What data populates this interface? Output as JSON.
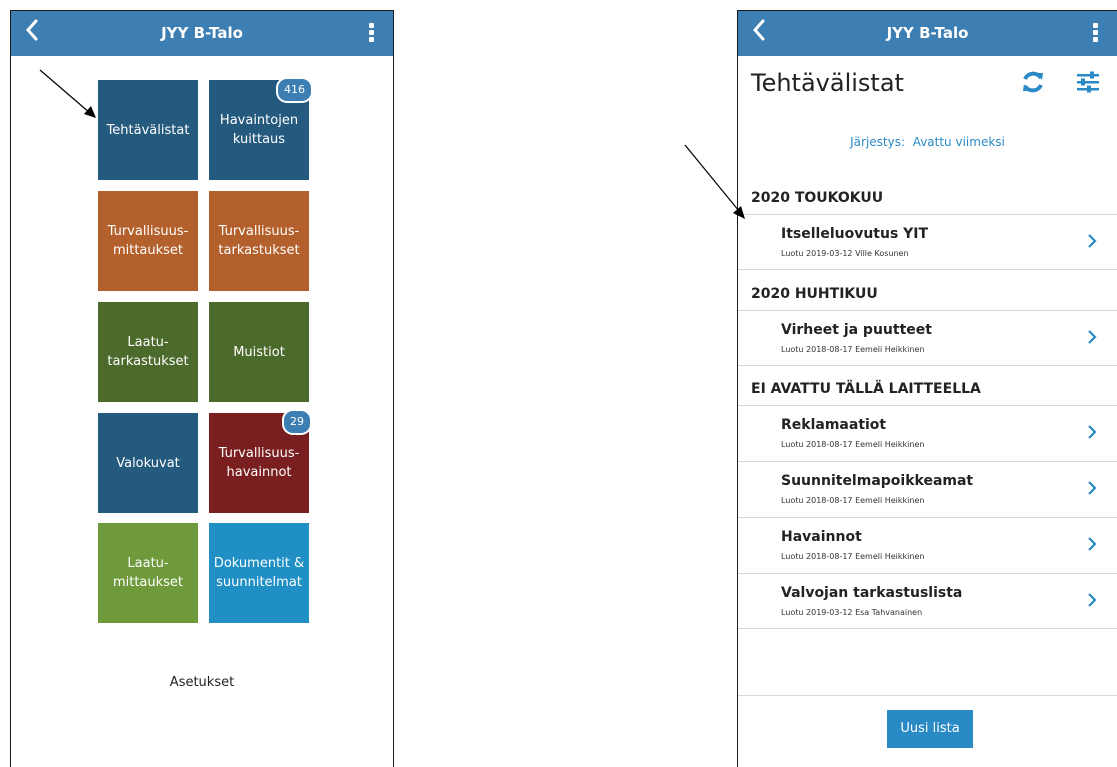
{
  "colors": {
    "appbar": "#3d7fb3",
    "tile_dark_blue": "#255a7f",
    "tile_orange": "#b4602c",
    "tile_dark_green": "#4c6a2b",
    "tile_dark_red": "#7a1f1f",
    "tile_light_green": "#6f9a3b",
    "tile_light_blue": "#1f8fc4",
    "accent_blue": "#2a8ac5"
  },
  "left_screen": {
    "appbar": {
      "title": "JYY B-Talo",
      "back_icon": "chevron-left-icon",
      "menu_icon": "kebab-menu-icon"
    },
    "tiles": [
      {
        "label": "Tehtävälistat",
        "color": "#255a7f"
      },
      {
        "label": "Havaintojen\nkuittaus",
        "color": "#255a7f",
        "badge": "416"
      },
      {
        "label": "Turvallisuus-\nmittaukset",
        "color": "#b4602c"
      },
      {
        "label": "Turvallisuus-\ntarkastukset",
        "color": "#b4602c"
      },
      {
        "label": "Laatu-\ntarkastukset",
        "color": "#4c6a2b"
      },
      {
        "label": "Muistiot",
        "color": "#4c6a2b"
      },
      {
        "label": "Valokuvat",
        "color": "#255a7f"
      },
      {
        "label": "Turvallisuus-\nhavainnot",
        "color": "#7a1f1f",
        "badge": "29"
      },
      {
        "label": "Laatu-\nmittaukset",
        "color": "#6f9a3b"
      },
      {
        "label": "Dokumentit &\nsuunnitelmat",
        "color": "#1f8fc4"
      }
    ],
    "settings_label": "Asetukset"
  },
  "right_screen": {
    "appbar": {
      "title": "JYY B-Talo",
      "back_icon": "chevron-left-icon",
      "menu_icon": "kebab-menu-icon"
    },
    "page_title": "Tehtävälistat",
    "refresh_icon": "refresh-icon",
    "filter_icon": "sliders-icon",
    "sort_label": "Järjestys:",
    "sort_value": "Avattu viimeksi",
    "sections": [
      {
        "title": "2020 TOUKOKUU",
        "items": [
          {
            "name": "Itselleluovutus YIT",
            "meta": "Luotu 2019-03-12 Ville Kosunen"
          }
        ]
      },
      {
        "title": "2020 HUHTIKUU",
        "items": [
          {
            "name": "Virheet ja puutteet",
            "meta": "Luotu 2018-08-17 Eemeli Heikkinen"
          }
        ]
      },
      {
        "title": "EI AVATTU TÄLLÄ LAITTEELLA",
        "items": [
          {
            "name": "Reklamaatiot",
            "meta": "Luotu 2018-08-17 Eemeli Heikkinen"
          },
          {
            "name": "Suunnitelmapoikkeamat",
            "meta": "Luotu 2018-08-17 Eemeli Heikkinen"
          },
          {
            "name": "Havainnot",
            "meta": "Luotu 2018-08-17 Eemeli Heikkinen"
          },
          {
            "name": "Valvojan tarkastuslista",
            "meta": "Luotu 2019-03-12 Esa Tahvanainen"
          }
        ]
      }
    ],
    "new_list_button": "Uusi lista"
  }
}
